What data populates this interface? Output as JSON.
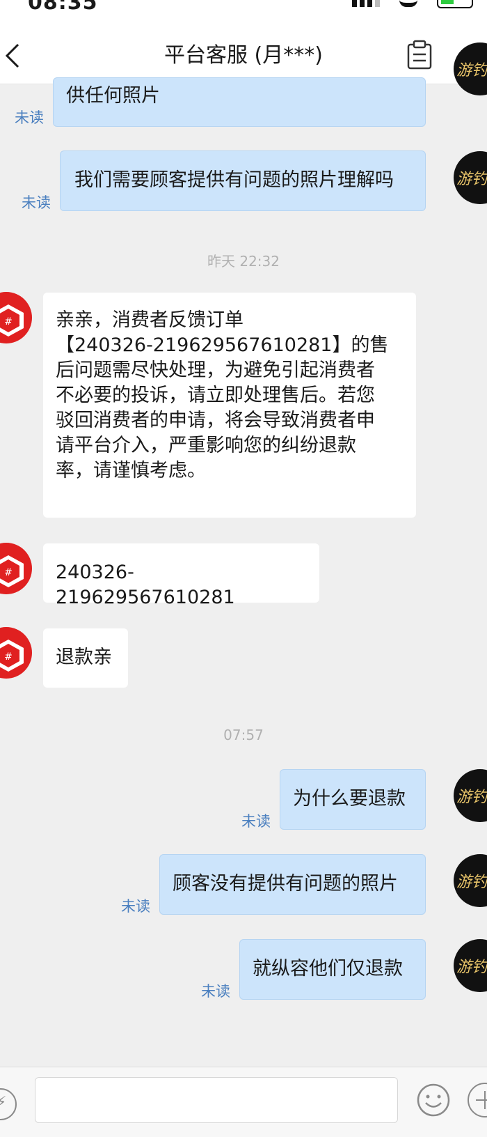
{
  "status_bar": {
    "time": "08:35"
  },
  "header": {
    "title": "平台客服 (月***)"
  },
  "messages": {
    "m1": {
      "text": "供任何照片",
      "status": "未读"
    },
    "m2": {
      "text": "我们需要顾客提供有问题的照片理解吗",
      "status": "未读"
    },
    "sep1": "昨天 22:32",
    "m3": {
      "text": "亲亲，消费者反馈订单\n【240326-219629567610281】的售\n后问题需尽快处理，为避免引起消费者\n不必要的投诉，请立即处理售后。若您\n驳回消费者的申请，将会导致消费者申\n请平台介入，严重影响您的纠纷退款\n率，请谨慎考虑。"
    },
    "m4": {
      "text": "240326-219629567610281"
    },
    "m5": {
      "text": "退款亲"
    },
    "sep2": "07:57",
    "m6": {
      "text": "为什么要退款",
      "status": "未读"
    },
    "m7": {
      "text": "顾客没有提供有问题的照片",
      "status": "未读"
    },
    "m8": {
      "text": "就纵容他们仅退款",
      "status": "未读"
    }
  },
  "avatars": {
    "self_logo": "游钓"
  },
  "colors": {
    "outgoing_bubble": "#cce4fb",
    "incoming_bubble": "#ffffff",
    "unread": "#4a7fbf",
    "platform_red": "#e02020"
  },
  "icons": [
    "back-icon",
    "clipboard-icon",
    "more-icon",
    "voice-icon",
    "emoji-icon",
    "plus-icon"
  ]
}
